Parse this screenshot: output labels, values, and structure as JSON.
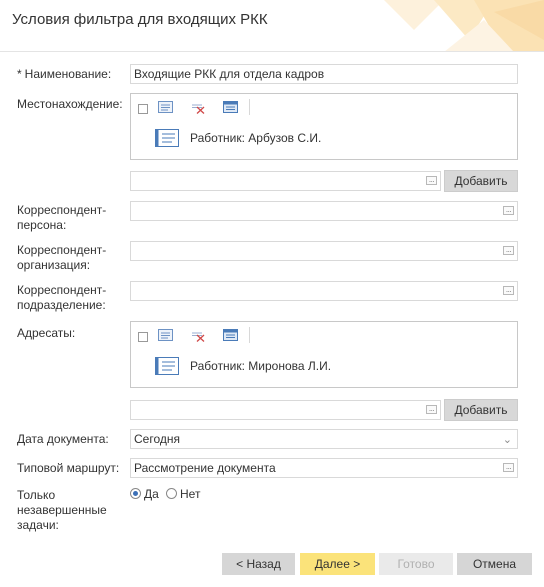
{
  "header": {
    "title": "Условия фильтра для входящих РКК"
  },
  "form": {
    "name": {
      "required_mark": "*",
      "label": "Наименование:",
      "value": "Входящие РКК для отдела кадров"
    },
    "location": {
      "label": "Местонахождение:",
      "entries": [
        {
          "text": "Работник: Арбузов С.И."
        }
      ],
      "input_value": "",
      "add_label": "Добавить"
    },
    "corr_person": {
      "label_l1": "Корреспондент-",
      "label_l2": "персона:",
      "value": ""
    },
    "corr_org": {
      "label_l1": "Корреспондент-",
      "label_l2": "организация:",
      "value": ""
    },
    "corr_dept": {
      "label_l1": "Корреспондент-",
      "label_l2": "подразделение:",
      "value": ""
    },
    "addressees": {
      "label": "Адресаты:",
      "entries": [
        {
          "text": "Работник: Миронова Л.И."
        }
      ],
      "input_value": "",
      "add_label": "Добавить"
    },
    "doc_date": {
      "label": "Дата документа:",
      "value": "Сегодня"
    },
    "route": {
      "label": "Типовой маршрут:",
      "value": "Рассмотрение документа"
    },
    "unfinished": {
      "label_l1": "Только",
      "label_l2": "незавершенные",
      "label_l3": "задачи:",
      "options": [
        {
          "label": "Да",
          "selected": true
        },
        {
          "label": "Нет",
          "selected": false
        }
      ]
    }
  },
  "footer": {
    "back": "< Назад",
    "next": "Далее >",
    "done": "Готово",
    "cancel": "Отмена"
  },
  "icons": {
    "toolbar": [
      "checkbox",
      "edit-card-icon",
      "remove-card-icon",
      "add-card-icon"
    ],
    "entry": "employee-card-icon",
    "browse": "ellipsis-icon",
    "dropdown": "chevron-down-icon"
  },
  "colors": {
    "accent_next_button": "#fbe37a",
    "radio_selected": "#3b6fb6",
    "button_gray": "#d6d6d6",
    "card_icon_blue": "#4a7bb8",
    "header_decoration": "#fce9c4"
  }
}
